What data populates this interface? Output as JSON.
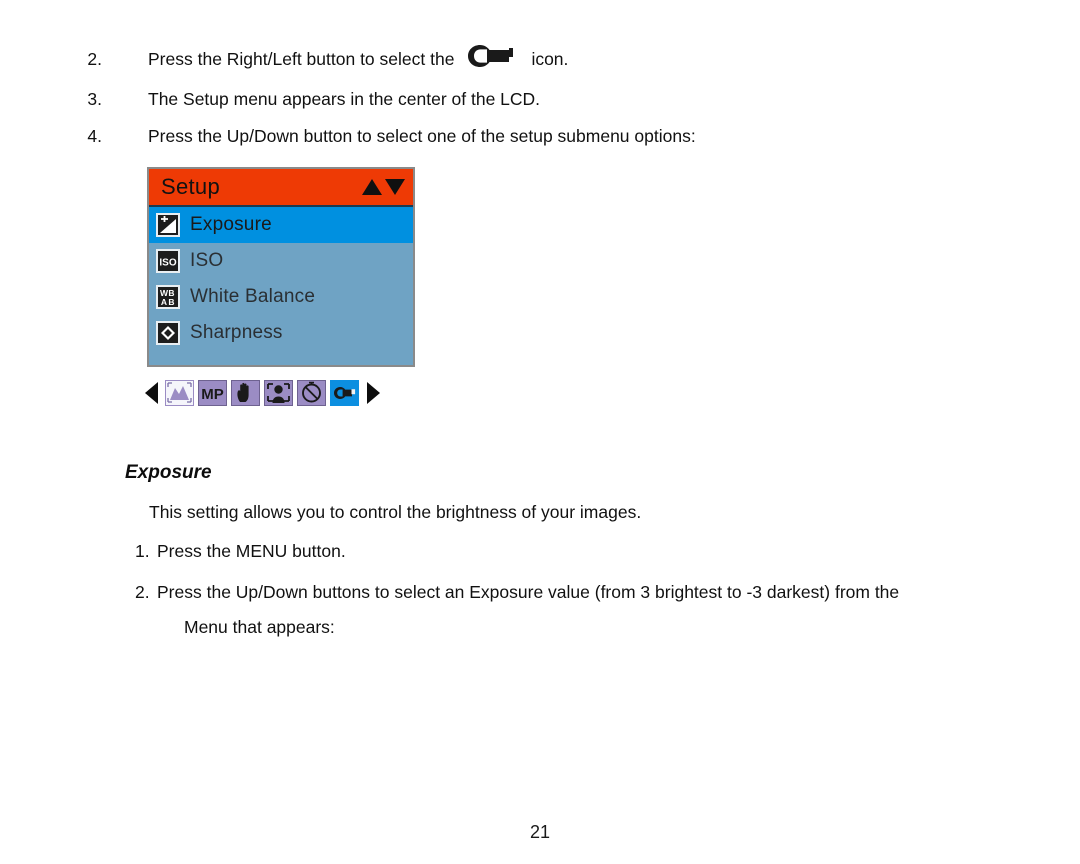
{
  "document": {
    "page_number": "21"
  },
  "steps": [
    {
      "number": "2.",
      "text_before": "Press the Right/Left button to select the",
      "icon": "wrench-icon",
      "text_after": "icon."
    },
    {
      "number": "3.",
      "text_before": "The Setup menu appears in the center of the LCD.",
      "icon": "",
      "text_after": ""
    },
    {
      "number": "4.",
      "text_before": "Press the Up/Down button to select one of the setup submenu options:",
      "icon": "",
      "text_after": ""
    }
  ],
  "lcd": {
    "title": "Setup",
    "header_color": "#ee3a05",
    "panel_color": "#6fa3c4",
    "highlight_color": "#0090e0",
    "scroll_up_icon": "triangle-up-icon",
    "scroll_down_icon": "triangle-down-icon",
    "menu_items": [
      {
        "label": "Exposure",
        "icon": "exposure-compensation-icon",
        "selected": true
      },
      {
        "label": "ISO",
        "icon": "iso-icon",
        "selected": false
      },
      {
        "label": "White Balance",
        "icon": "white-balance-icon",
        "selected": false
      },
      {
        "label": "Sharpness",
        "icon": "sharpness-icon",
        "selected": false
      }
    ],
    "mode_bar": {
      "prev_icon": "arrow-left-icon",
      "next_icon": "arrow-right-icon",
      "icons": [
        {
          "name": "scene-mode-icon",
          "style": "white",
          "active": false
        },
        {
          "name": "megapixel-icon",
          "style": "purple",
          "active": false,
          "label": "MP"
        },
        {
          "name": "anti-shake-hand-icon",
          "style": "purple",
          "active": false
        },
        {
          "name": "face-detect-icon",
          "style": "purple",
          "active": false
        },
        {
          "name": "self-timer-icon",
          "style": "purple",
          "active": false
        },
        {
          "name": "setup-wrench-icon",
          "style": "blue",
          "active": true
        }
      ]
    }
  },
  "section": {
    "heading": "Exposure",
    "description": "This setting allows you to control the brightness of your images.",
    "instructions": [
      {
        "number": "1.",
        "text": "Press the MENU button.",
        "continuation": ""
      },
      {
        "number": "2.",
        "text": "Press the Up/Down buttons to select an Exposure value (from 3 brightest to -3 darkest) from the",
        "continuation": "Menu that appears:"
      }
    ]
  }
}
